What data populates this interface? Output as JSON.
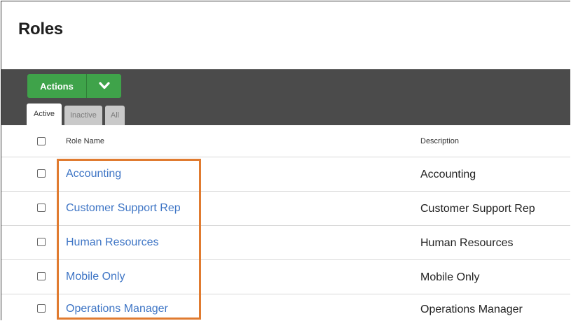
{
  "page": {
    "title": "Roles"
  },
  "toolbar": {
    "actions_label": "Actions",
    "caret_icon": "chevron-down-icon"
  },
  "tabs": [
    {
      "label": "Active",
      "state": "active"
    },
    {
      "label": "Inactive",
      "state": "inactive"
    },
    {
      "label": "All",
      "state": "inactive"
    }
  ],
  "table": {
    "columns": {
      "role_name": "Role Name",
      "description": "Description"
    },
    "rows": [
      {
        "role": "Accounting",
        "description": "Accounting"
      },
      {
        "role": "Customer Support Rep",
        "description": "Customer Support Rep"
      },
      {
        "role": "Human Resources",
        "description": "Human Resources"
      },
      {
        "role": "Mobile Only",
        "description": "Mobile Only"
      },
      {
        "role": "Operations Manager",
        "description": "Operations Manager"
      }
    ]
  },
  "colors": {
    "toolbar_bg": "#4b4b4b",
    "actions_green": "#3fa34a",
    "link_blue": "#3e75c5",
    "highlight_orange": "#e07b30"
  }
}
